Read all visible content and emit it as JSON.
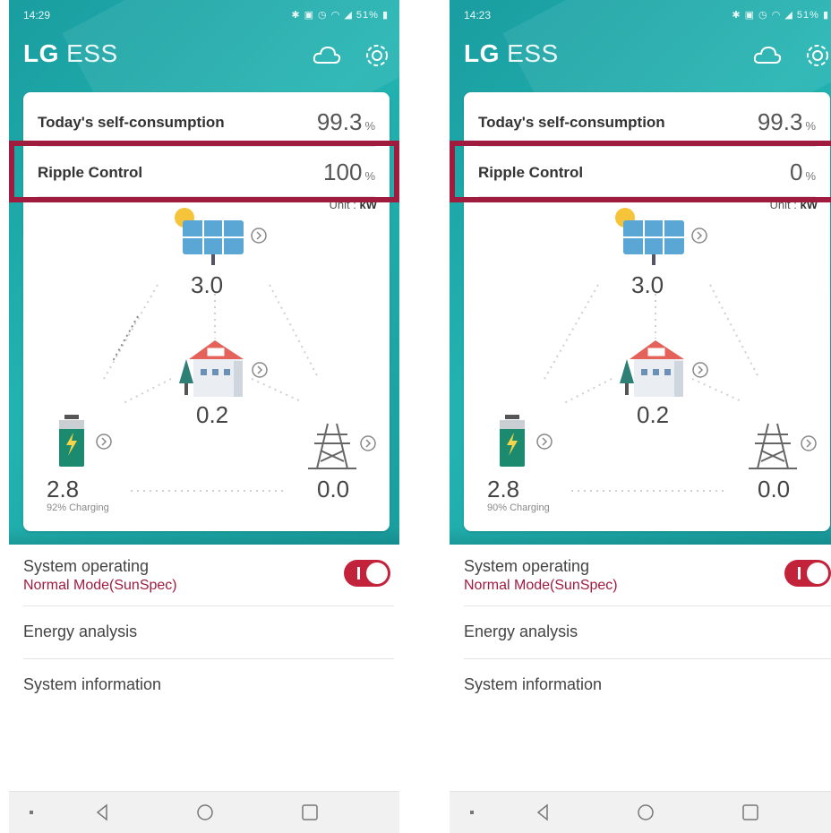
{
  "screens": [
    {
      "status_time": "14:29",
      "status_icons": "✱ ▣ ◷ ◠ ◢ 51% ▮",
      "brand_lg": "LG",
      "brand_ess": "ESS",
      "self_consumption_label": "Today's self-consumption",
      "self_consumption_value": "99.3",
      "self_consumption_unit": "%",
      "ripple_label": "Ripple Control",
      "ripple_value": "100",
      "ripple_unit": "%",
      "unit_label": "Unit : ",
      "unit_value": "kW",
      "solar_kw": "3.0",
      "home_kw": "0.2",
      "battery_kw": "2.8",
      "battery_status": "92% Charging",
      "grid_kw": "0.0",
      "system_operating_label": "System operating",
      "system_mode": "Normal Mode(SunSpec)",
      "toggle_on": true,
      "energy_analysis_label": "Energy analysis",
      "system_information_label": "System information"
    },
    {
      "status_time": "14:23",
      "status_icons": "✱ ▣ ◷ ◠ ◢ 51% ▮",
      "brand_lg": "LG",
      "brand_ess": "ESS",
      "self_consumption_label": "Today's self-consumption",
      "self_consumption_value": "99.3",
      "self_consumption_unit": "%",
      "ripple_label": "Ripple Control",
      "ripple_value": "0",
      "ripple_unit": "%",
      "unit_label": "Unit : ",
      "unit_value": "kW",
      "solar_kw": "3.0",
      "home_kw": "0.2",
      "battery_kw": "2.8",
      "battery_status": "90% Charging",
      "grid_kw": "0.0",
      "system_operating_label": "System operating",
      "system_mode": "Normal Mode(SunSpec)",
      "toggle_on": true,
      "energy_analysis_label": "Energy analysis",
      "system_information_label": "System information"
    }
  ],
  "colors": {
    "teal": "#1fa9a8",
    "highlight": "#a01c3f",
    "toggle": "#c3223b"
  },
  "icons": [
    "cloud-icon",
    "gear-icon",
    "sun-icon",
    "solar-panel-icon",
    "house-icon",
    "tree-icon",
    "battery-icon",
    "lightning-icon",
    "power-tower-icon",
    "chevron-right-icon",
    "back-icon",
    "home-circle-icon",
    "recents-square-icon",
    "dot-icon"
  ]
}
